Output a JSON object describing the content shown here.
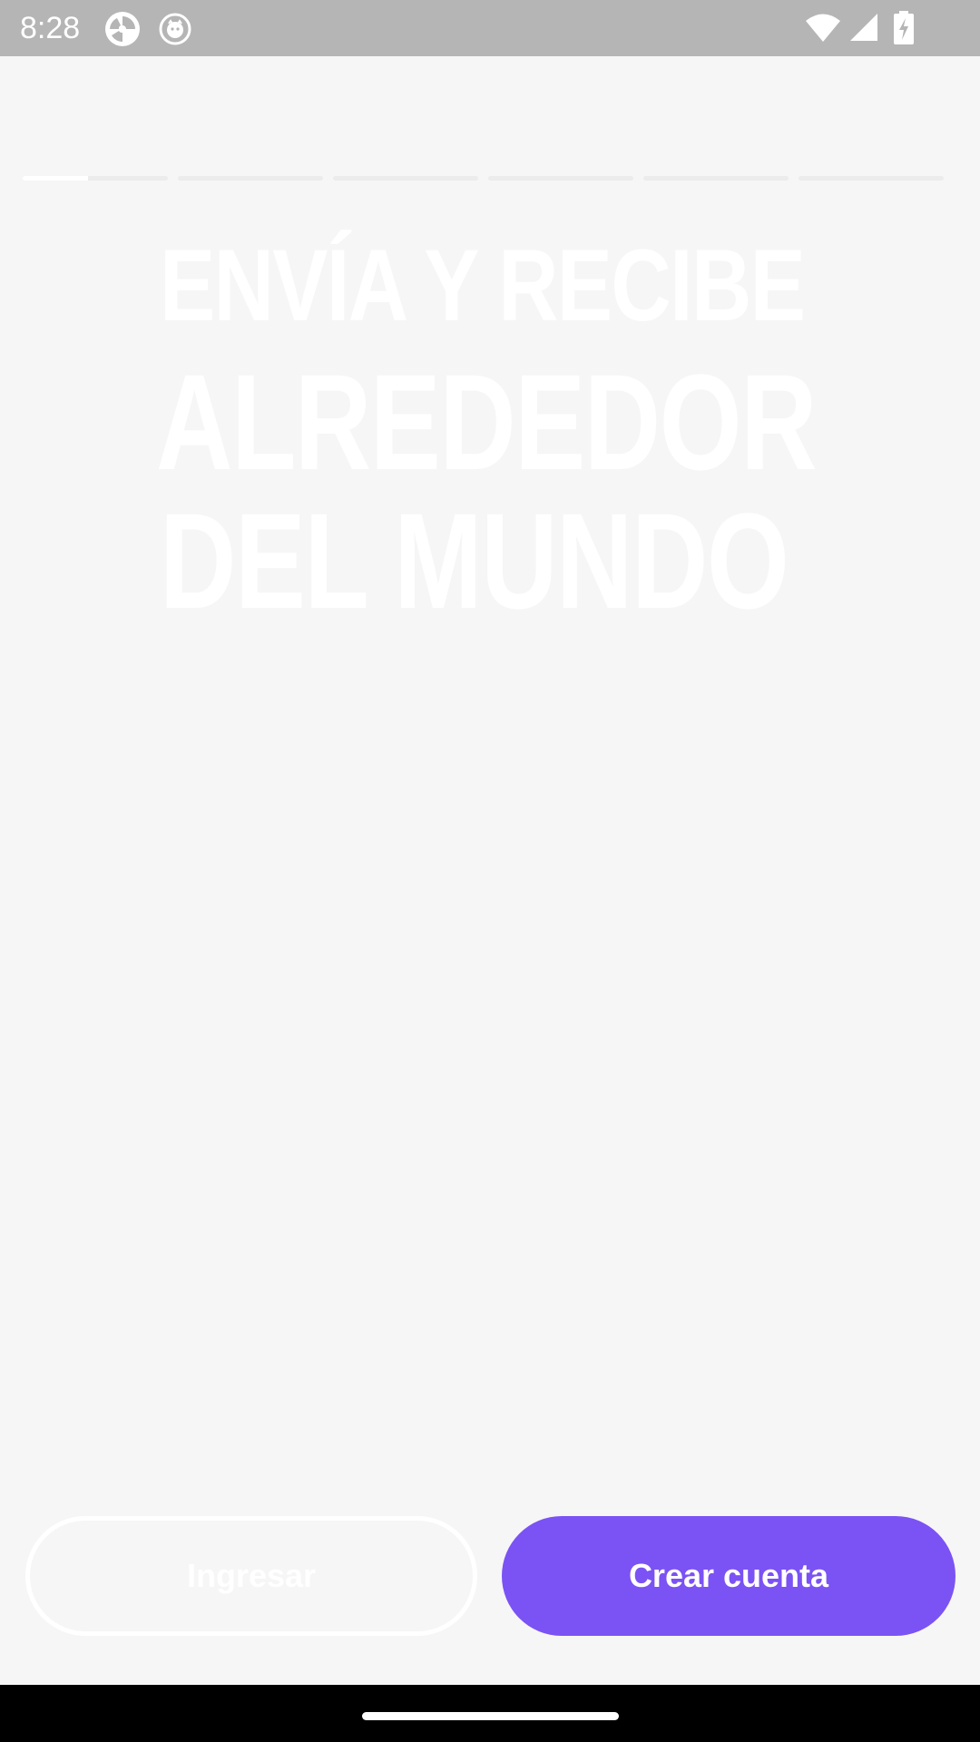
{
  "status_bar": {
    "time": "8:28",
    "icons": [
      "app-notification-icon",
      "app-notification-icon",
      "wifi-icon",
      "cell-signal-icon",
      "battery-charging-icon"
    ]
  },
  "onboarding": {
    "total_slides": 6,
    "current_slide": 1,
    "current_slide_progress": 0.45,
    "headline": {
      "line1": "ENVÍA Y RECIBE",
      "line2": "ALREDEDOR",
      "line3": "DEL MUNDO"
    }
  },
  "actions": {
    "login_label": "Ingresar",
    "create_account_label": "Crear cuenta"
  },
  "colors": {
    "accent": "#7b52f4",
    "background": "#f6f6f6",
    "status_bar": "#b5b5b5"
  }
}
